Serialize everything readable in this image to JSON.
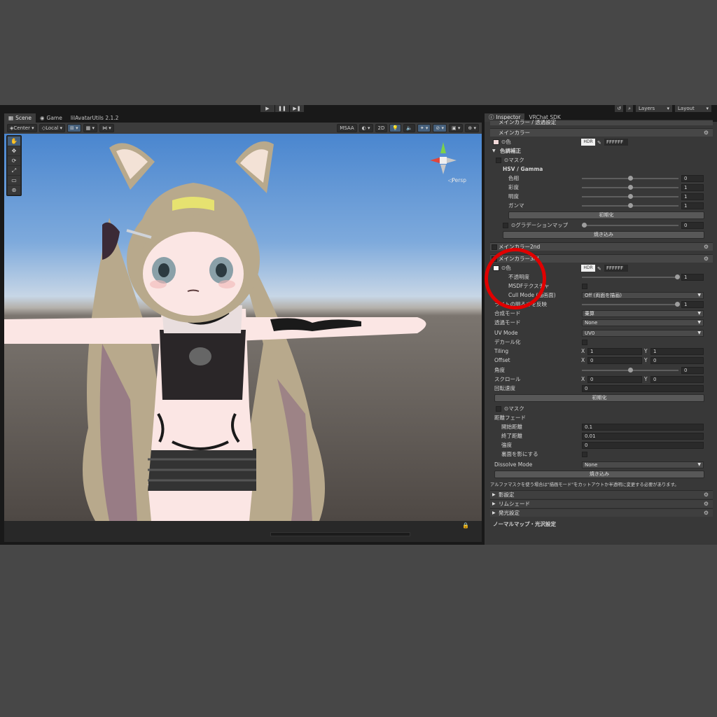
{
  "topbar": {
    "play": "▶",
    "pause": "❚❚",
    "step": "▶❚",
    "layers": "Layers",
    "layout": "Layout"
  },
  "scene": {
    "tabs": [
      {
        "label": "Scene",
        "icon": "scene-icon"
      },
      {
        "label": "Game",
        "icon": "game-icon"
      },
      {
        "label": "lilAvatarUtils 2.1.2",
        "icon": ""
      }
    ],
    "toolbar": {
      "pivot": "Center",
      "space": "Local",
      "msaa": "MSAA",
      "mode2d": "2D"
    },
    "persp_label": "◁Persp"
  },
  "inspector": {
    "tabs": [
      {
        "label": "Inspector",
        "icon": "info-icon"
      },
      {
        "label": "VRChat SDK",
        "icon": ""
      }
    ],
    "top_cut": "メインカラー / 透過設定",
    "main_color_header": "メインカラー",
    "color_label": "⊙色",
    "hdr": "HDR",
    "hex": "FFFFFF",
    "color_correction": "色調補正",
    "mask": "⊙マスク",
    "hsv_title": "HSV / Gamma",
    "hsv_rows": [
      {
        "label": "色相",
        "value": "0"
      },
      {
        "label": "彩度",
        "value": "1"
      },
      {
        "label": "明度",
        "value": "1"
      },
      {
        "label": "ガンマ",
        "value": "1"
      }
    ],
    "reset": "初期化",
    "gradation_map": "⊙グラデーションマップ",
    "gradation_value": "0",
    "bake": "焼き込み",
    "main_color_2nd": "メインカラー2nd",
    "main_color_3rd": "メインカラー3rd",
    "third": {
      "color_label": "⊙色",
      "hex": "FFFFFF",
      "opacity_label": "不透明度",
      "opacity_value": "1",
      "msdf_label": "MSDFテクスチャ",
      "cull_label": "Cull Mode (描画面)",
      "cull_value": "Off (両面を描画)",
      "light_label": "ライトの明るさを反映",
      "light_value": "1",
      "blend_label": "合成モード",
      "blend_value": "乗算",
      "alpha_label": "透過モード",
      "alpha_value": "None",
      "uv_label": "UV Mode",
      "uv_value": "UV0",
      "decal_label": "デカール化",
      "tiling_label": "Tiling",
      "tiling_x": "1",
      "tiling_y": "1",
      "offset_label": "Offset",
      "offset_x": "0",
      "offset_y": "0",
      "angle_label": "角度",
      "angle_value": "0",
      "scroll_label": "スクロール",
      "scroll_x": "0",
      "scroll_y": "0",
      "rotate_label": "回転速度",
      "rotate_value": "0",
      "reset": "初期化",
      "mask": "⊙マスク",
      "dist_fade": "距離フェード",
      "start_label": "開始距離",
      "start_value": "0.1",
      "end_label": "終了距離",
      "end_value": "0.01",
      "strength_label": "強度",
      "strength_value": "0",
      "backface_label": "裏面を影にする",
      "dissolve_label": "Dissolve Mode",
      "dissolve_value": "None",
      "bake": "焼き込み"
    },
    "alpha_note": "アルファマスクを使う場合は\"描画モード\"をカットアウトか半透明に変更する必要があります。",
    "shadow": "影設定",
    "rim": "リムシェード",
    "emission": "発光設定",
    "normal_gloss": "ノーマルマップ・光沢設定",
    "axis_x": "X",
    "axis_y": "Y"
  },
  "colors": {
    "accent_blue": "#46607c",
    "highlight_red": "#e00000"
  }
}
